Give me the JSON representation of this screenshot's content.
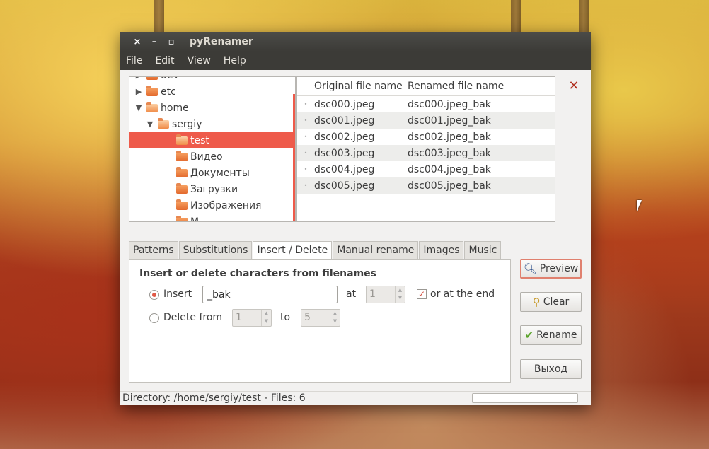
{
  "window": {
    "title": "pyRenamer",
    "controls": {
      "close": "×",
      "minimize": "–",
      "maximize": "▫"
    }
  },
  "menu": [
    "File",
    "Edit",
    "View",
    "Help"
  ],
  "tree": {
    "items": [
      {
        "label": "dev",
        "indent": 1,
        "expander": "▶",
        "open": false,
        "selected": false
      },
      {
        "label": "etc",
        "indent": 1,
        "expander": "▶",
        "open": false,
        "selected": false
      },
      {
        "label": "home",
        "indent": 1,
        "expander": "▼",
        "open": true,
        "selected": false
      },
      {
        "label": "sergiy",
        "indent": 2,
        "expander": "▼",
        "open": true,
        "selected": false
      },
      {
        "label": "test",
        "indent": 3,
        "expander": "",
        "open": true,
        "selected": true
      },
      {
        "label": "Видео",
        "indent": 3,
        "expander": "",
        "open": false,
        "selected": false
      },
      {
        "label": "Документы",
        "indent": 3,
        "expander": "",
        "open": false,
        "selected": false
      },
      {
        "label": "Загрузки",
        "indent": 3,
        "expander": "",
        "open": false,
        "selected": false
      },
      {
        "label": "Изображения",
        "indent": 3,
        "expander": "",
        "open": false,
        "selected": false
      },
      {
        "label": "М...",
        "indent": 3,
        "expander": "",
        "open": false,
        "selected": false
      }
    ]
  },
  "files": {
    "headers": {
      "original": "Original file name",
      "renamed": "Renamed file name"
    },
    "rows": [
      {
        "original": "dsc000.jpeg",
        "renamed": "dsc000.jpeg_bak"
      },
      {
        "original": "dsc001.jpeg",
        "renamed": "dsc001.jpeg_bak"
      },
      {
        "original": "dsc002.jpeg",
        "renamed": "dsc002.jpeg_bak"
      },
      {
        "original": "dsc003.jpeg",
        "renamed": "dsc003.jpeg_bak"
      },
      {
        "original": "dsc004.jpeg",
        "renamed": "dsc004.jpeg_bak"
      },
      {
        "original": "dsc005.jpeg",
        "renamed": "dsc005.jpeg_bak"
      }
    ]
  },
  "tabs": [
    {
      "label": "Patterns",
      "active": false
    },
    {
      "label": "Substitutions",
      "active": false
    },
    {
      "label": "Insert / Delete",
      "active": true
    },
    {
      "label": "Manual rename",
      "active": false
    },
    {
      "label": "Images",
      "active": false
    },
    {
      "label": "Music",
      "active": false
    }
  ],
  "insert_delete": {
    "heading": "Insert or delete characters from filenames",
    "insert_label": "Insert",
    "insert_value": "_bak",
    "at_label": "at",
    "at_value": "1",
    "at_end_label": "or at the end",
    "at_end_checked": true,
    "delete_label": "Delete from",
    "delete_from_value": "1",
    "to_label": "to",
    "delete_to_value": "5",
    "insert_selected": true
  },
  "buttons": {
    "preview": "Preview",
    "clear": "Clear",
    "rename": "Rename",
    "exit": "Выход"
  },
  "status": {
    "text": "Directory: /home/sergiy/test - Files: 6",
    "progress": 0
  },
  "colors": {
    "accent": "#ee5a4a",
    "titlebar": "#3c3b37",
    "window_bg": "#f2f1f0"
  }
}
